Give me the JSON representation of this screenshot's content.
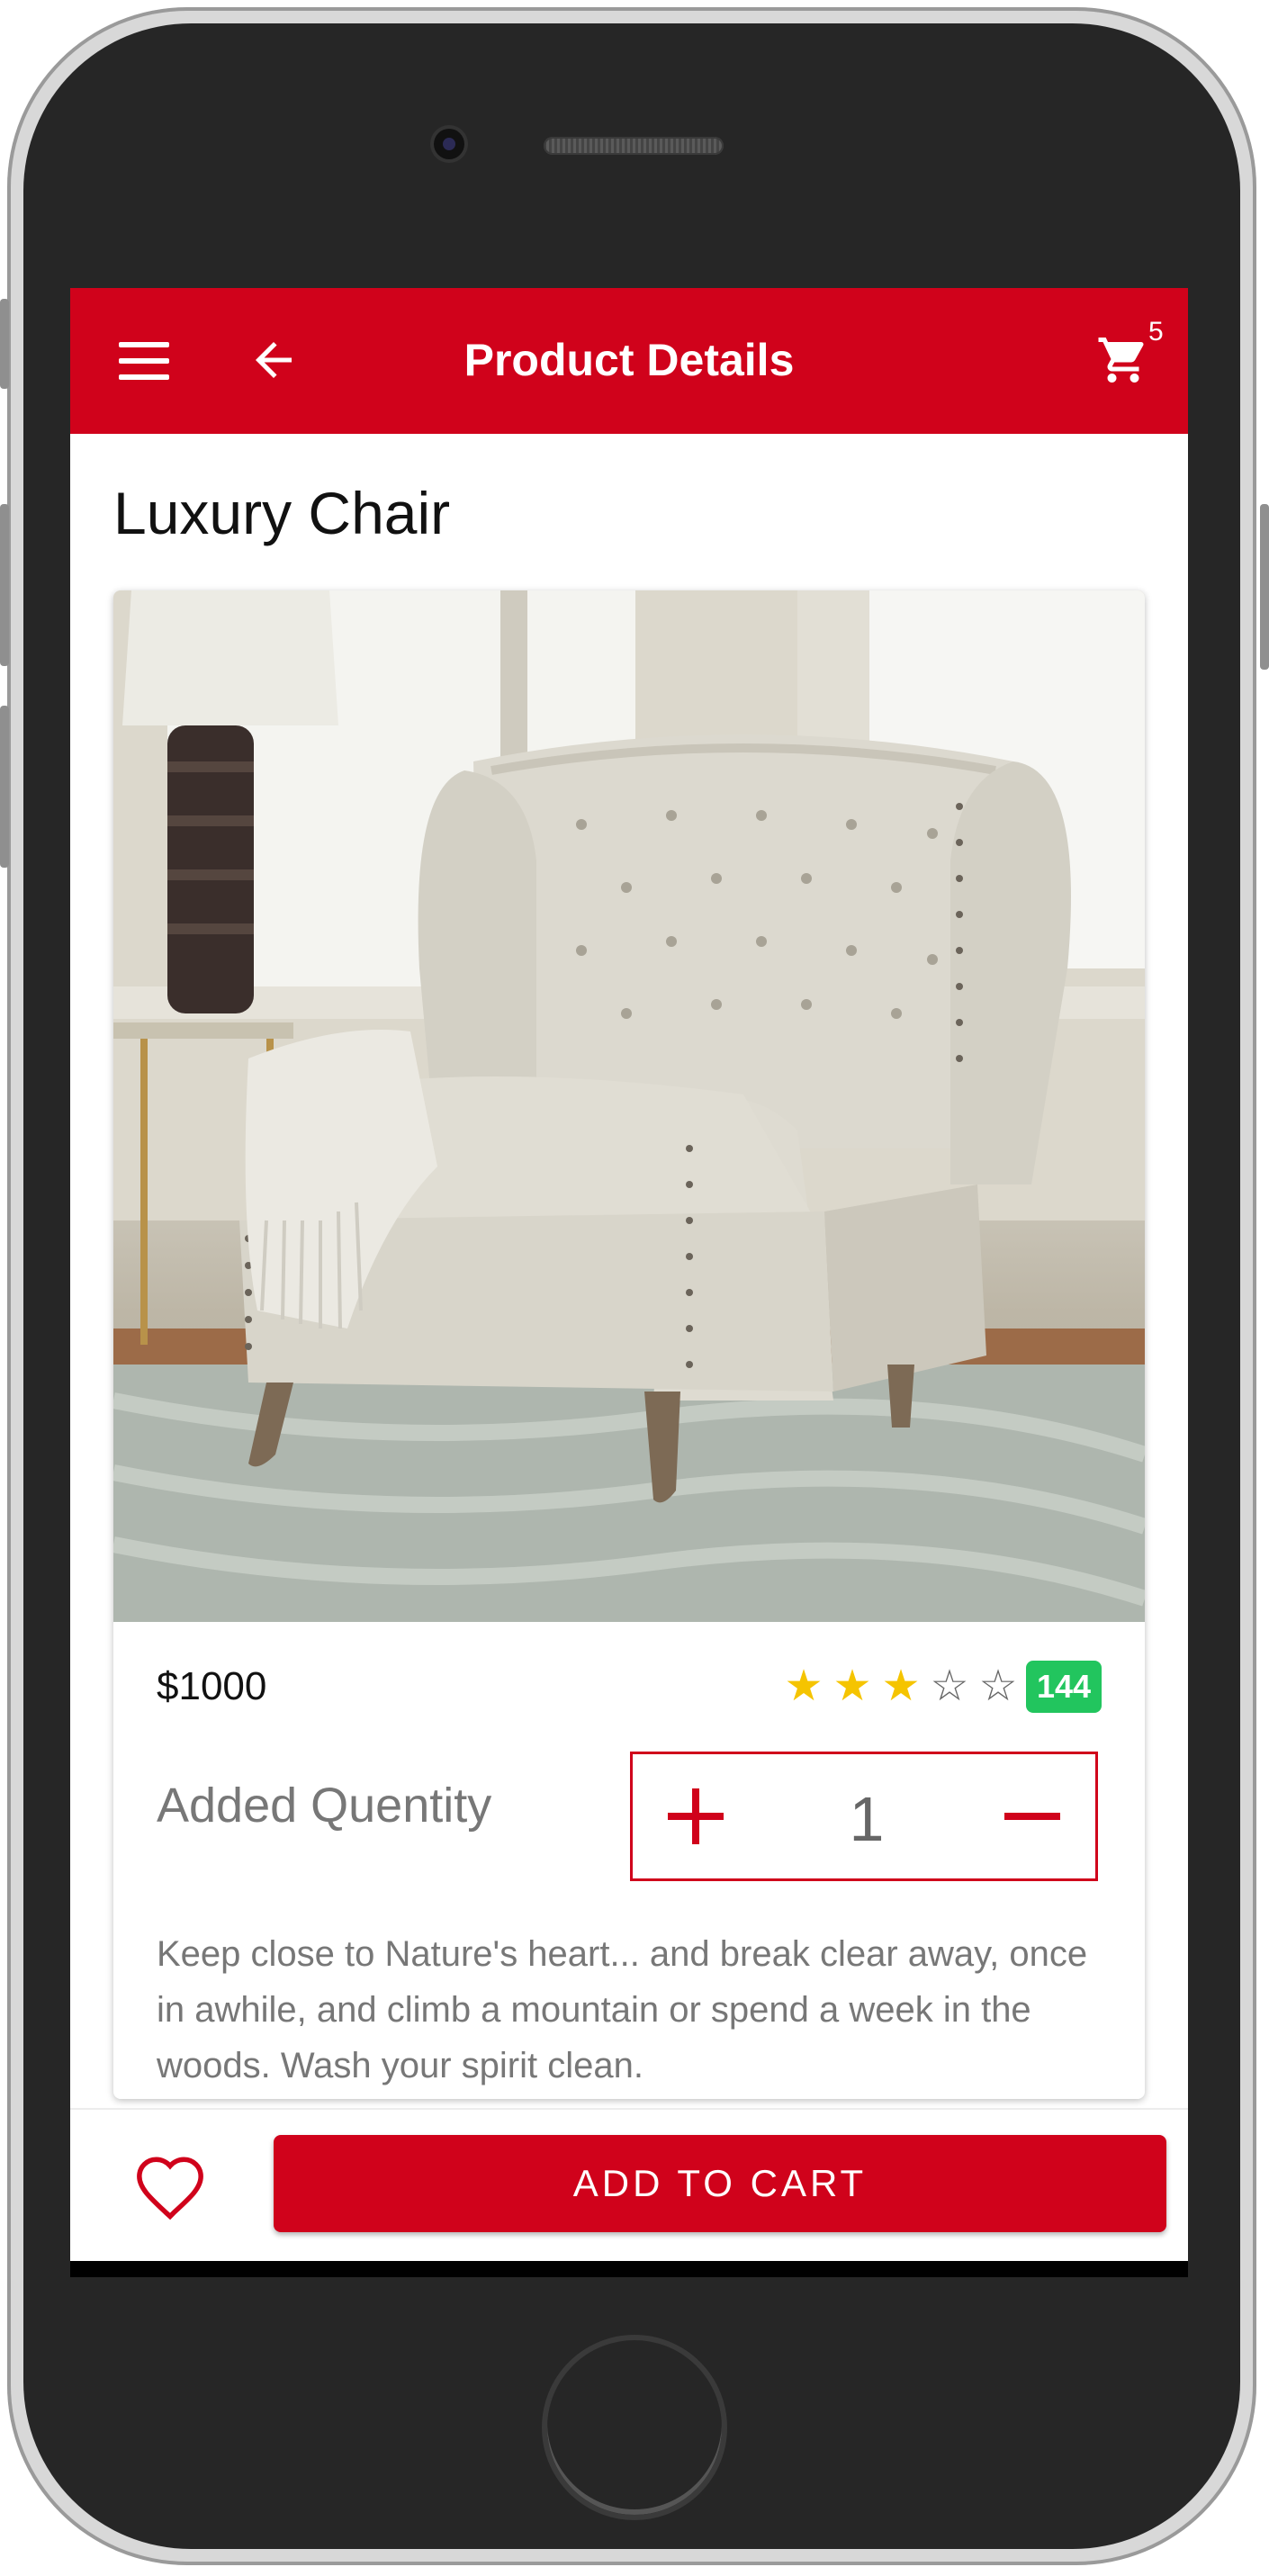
{
  "appbar": {
    "title": "Product Details",
    "cart_count": "5",
    "icons": [
      "menu-icon",
      "back-arrow-icon",
      "cart-icon"
    ]
  },
  "product": {
    "name": "Luxury Chair",
    "price": "$1000",
    "rating": {
      "stars_filled": 3,
      "stars_total": 5,
      "count": "144"
    },
    "quantity_label": "Added Quentity",
    "quantity": "1",
    "description": "Keep close to Nature's heart... and break clear away, once in awhile, and climb a mountain or spend a week in the woods. Wash your spirit clean."
  },
  "actions": {
    "add_to_cart_label": "ADD TO CART",
    "favorite_icon": "heart-icon"
  },
  "colors": {
    "primary": "#d0021b",
    "star": "#f5c400",
    "badge": "#22c55e"
  }
}
